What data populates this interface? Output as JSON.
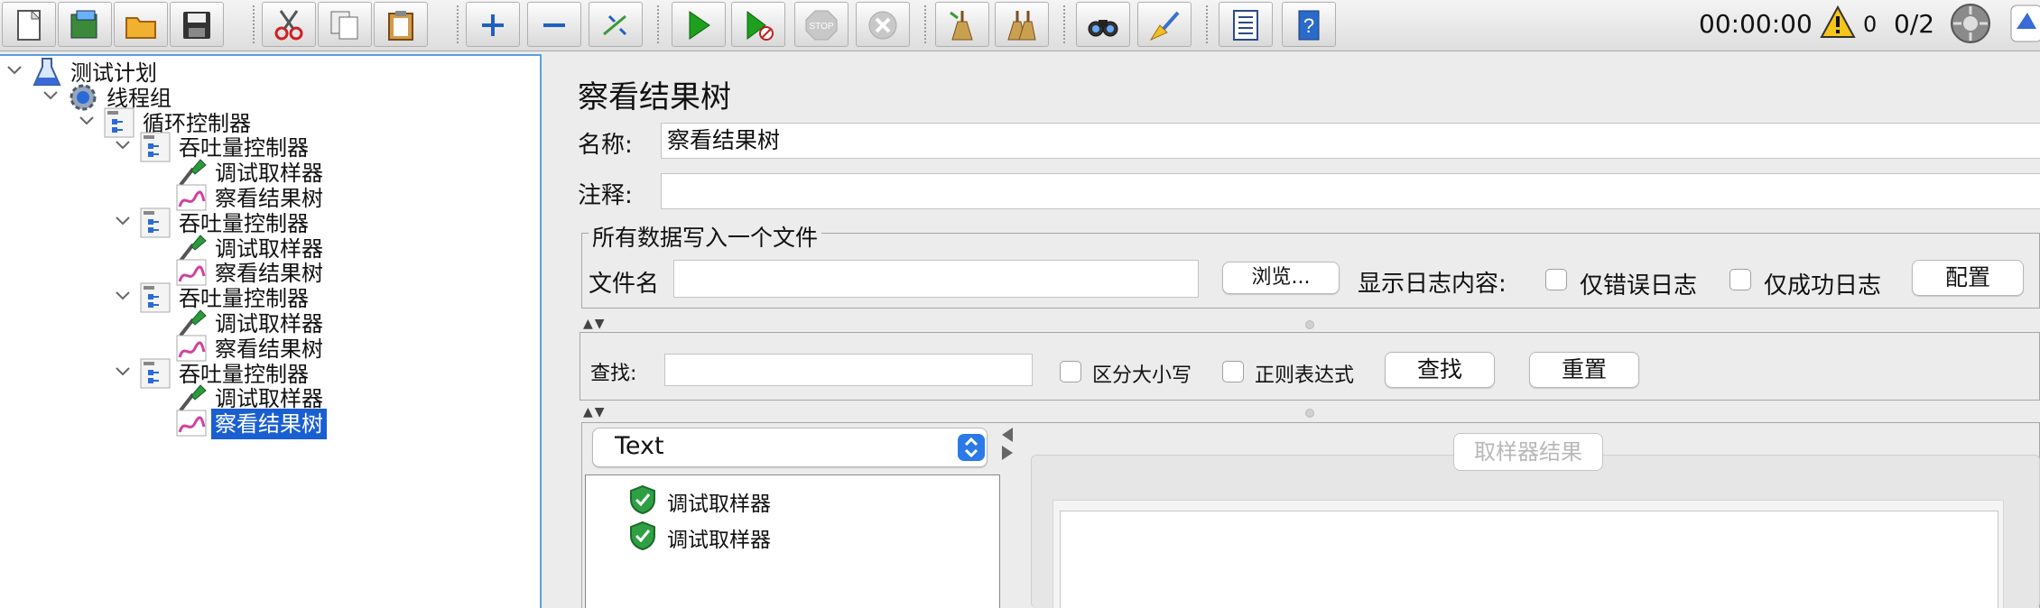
{
  "toolbar": {
    "buttons": [
      {
        "name": "new-icon"
      },
      {
        "name": "templates-icon"
      },
      {
        "name": "open-icon"
      },
      {
        "name": "save-icon"
      },
      {
        "name": "cut-icon"
      },
      {
        "name": "copy-icon"
      },
      {
        "name": "paste-icon"
      },
      {
        "name": "expand-icon"
      },
      {
        "name": "collapse-icon"
      },
      {
        "name": "toggle-icon"
      },
      {
        "name": "start-icon"
      },
      {
        "name": "start-no-pauses-icon"
      },
      {
        "name": "stop-icon"
      },
      {
        "name": "shutdown-icon"
      },
      {
        "name": "clear-icon"
      },
      {
        "name": "clear-all-icon"
      },
      {
        "name": "search-icon"
      },
      {
        "name": "reset-search-icon"
      },
      {
        "name": "function-helper-icon"
      },
      {
        "name": "help-icon"
      }
    ],
    "timer": "00:00:00",
    "warning_count": "0",
    "threads": "0/2",
    "stop_label": "STOP"
  },
  "tree": {
    "nodes": [
      {
        "label": "测试计划",
        "icon": "flask-icon"
      },
      {
        "label": "线程组",
        "icon": "gear-icon"
      },
      {
        "label": "循环控制器",
        "icon": "controller-icon"
      },
      {
        "label": "吞吐量控制器",
        "icon": "controller-icon"
      },
      {
        "label": "调试取样器",
        "icon": "pipette-icon"
      },
      {
        "label": "察看结果树",
        "icon": "graph-icon"
      },
      {
        "label": "吞吐量控制器",
        "icon": "controller-icon"
      },
      {
        "label": "调试取样器",
        "icon": "pipette-icon"
      },
      {
        "label": "察看结果树",
        "icon": "graph-icon"
      },
      {
        "label": "吞吐量控制器",
        "icon": "controller-icon"
      },
      {
        "label": "调试取样器",
        "icon": "pipette-icon"
      },
      {
        "label": "察看结果树",
        "icon": "graph-icon"
      },
      {
        "label": "吞吐量控制器",
        "icon": "controller-icon"
      },
      {
        "label": "调试取样器",
        "icon": "pipette-icon"
      },
      {
        "label": "察看结果树",
        "icon": "graph-icon"
      }
    ]
  },
  "panel": {
    "title": "察看结果树",
    "name_label": "名称:",
    "name_value": "察看结果树",
    "comment_label": "注释:",
    "comment_value": "",
    "file_group_title": "所有数据写入一个文件",
    "filename_label": "文件名",
    "filename_value": "",
    "browse_button": "浏览...",
    "log_display_label": "显示日志内容:",
    "errors_only_label": "仅错误日志",
    "success_only_label": "仅成功日志",
    "configure_button": "配置",
    "search_label": "查找:",
    "search_value": "",
    "case_sensitive_label": "区分大小写",
    "regex_label": "正则表达式",
    "search_button": "查找",
    "reset_button": "重置",
    "renderer_selected": "Text",
    "results": [
      {
        "label": "调试取样器",
        "status": "success"
      },
      {
        "label": "调试取样器",
        "status": "success"
      }
    ],
    "sampler_result_tab": "取样器结果"
  },
  "colors": {
    "selection": "#1a5fd1",
    "success_shield": "#2ea043",
    "accent_border": "#5aa0e0"
  }
}
